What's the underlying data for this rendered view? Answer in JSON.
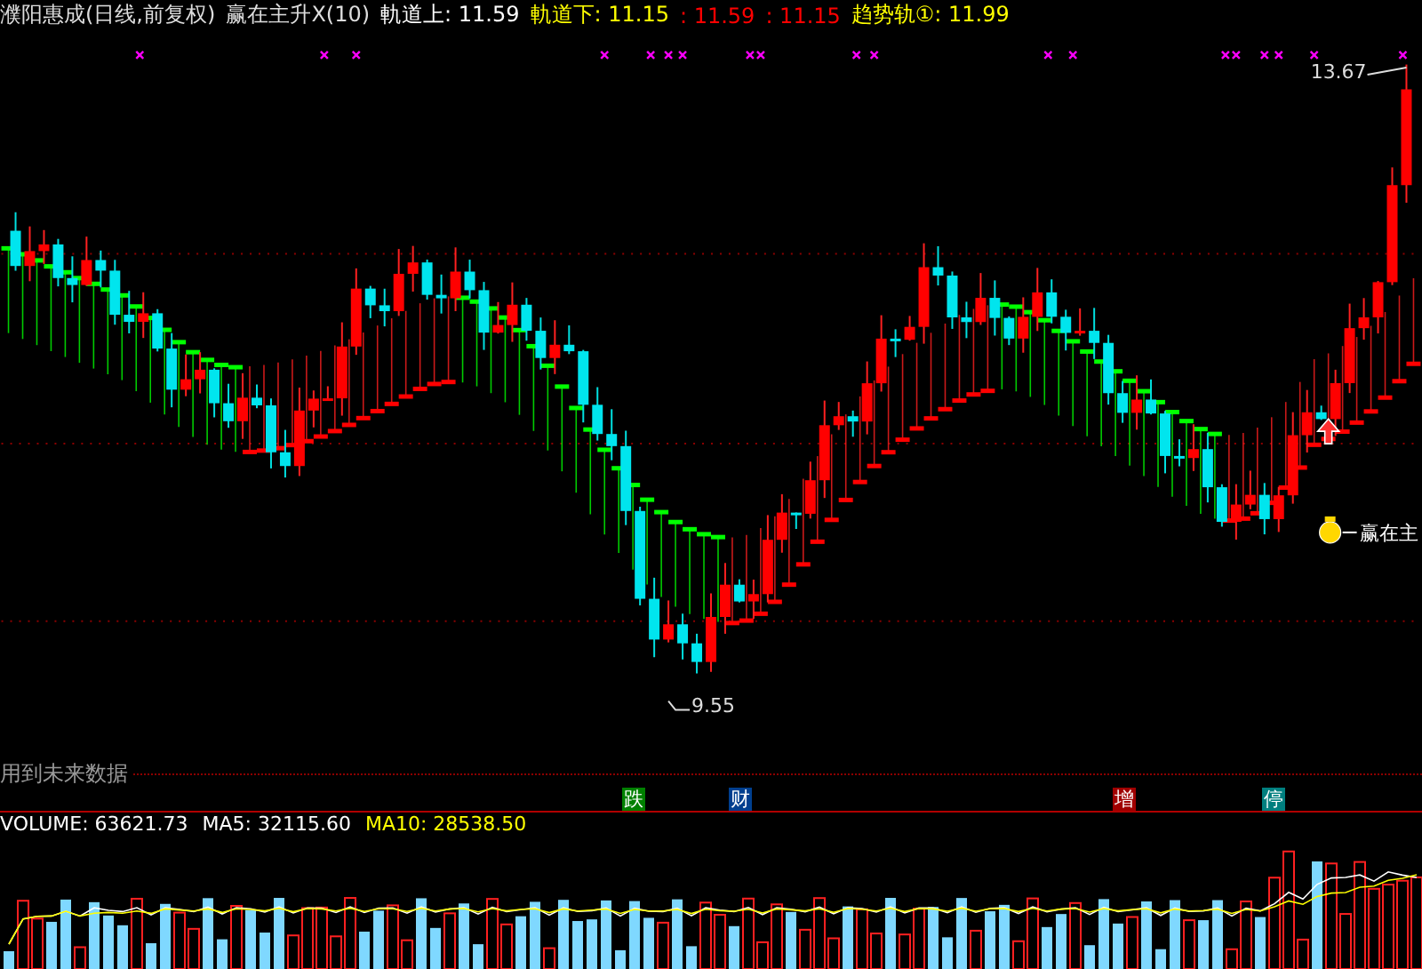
{
  "header": {
    "title": "濮阳惠成(日线,前复权)",
    "indicator": "赢在主升X(10)",
    "readouts": [
      {
        "text": "軌道上: 11.59",
        "color": "#ffffff"
      },
      {
        "text": "軌道下: 11.15",
        "color": "#ffff00"
      },
      {
        "text": ": 11.59",
        "color": "#ff0000"
      },
      {
        "text": ": 11.15",
        "color": "#ff0000"
      },
      {
        "text": "趋势轨①: 11.99",
        "color": "#ffff00"
      }
    ]
  },
  "chart": {
    "high_label": "13.67",
    "low_label": "9.55",
    "signal_label": "赢在主",
    "future_note": "用到未来数据"
  },
  "badges": [
    {
      "text": "跌",
      "color": "#008000"
    },
    {
      "text": "财",
      "color": "#003f8f"
    },
    {
      "text": "增",
      "color": "#a00000"
    },
    {
      "text": "停",
      "color": "#007f7f"
    }
  ],
  "volume": {
    "readouts": [
      {
        "text": "VOLUME: 63621.73",
        "color": "#ffffff"
      },
      {
        "text": "MA5: 32115.60",
        "color": "#ffffff"
      },
      {
        "text": "MA10: 28538.50",
        "color": "#ffff00"
      }
    ]
  }
}
